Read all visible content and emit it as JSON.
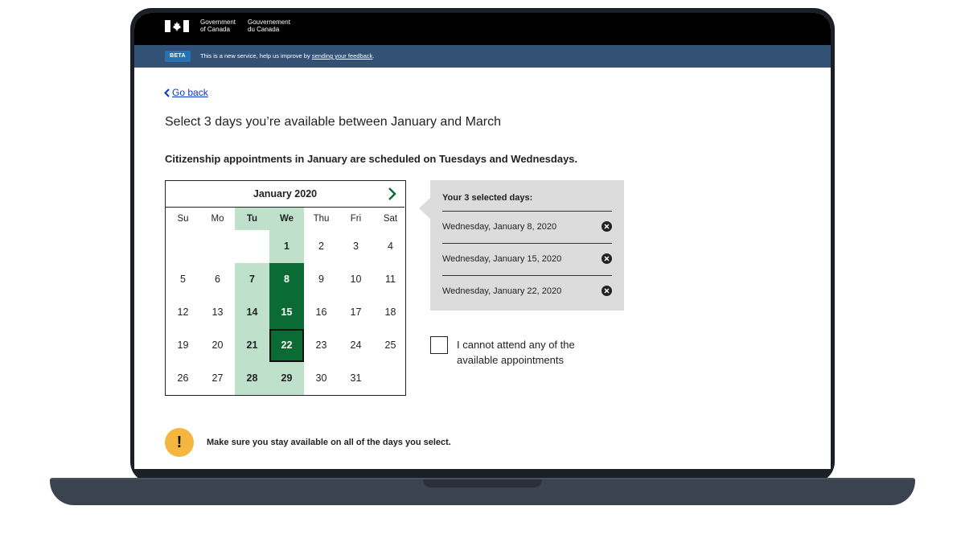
{
  "header": {
    "gov_en_line1": "Government",
    "gov_en_line2": "of Canada",
    "gov_fr_line1": "Gouvernement",
    "gov_fr_line2": "du Canada"
  },
  "beta": {
    "badge": "BETA",
    "message": "This is a new service, help us improve by ",
    "link": "sending your feedback",
    "suffix": "."
  },
  "nav": {
    "go_back": "Go back"
  },
  "page": {
    "title": "Select 3 days you’re available between January and March",
    "subhead": "Citizenship appointments in January are scheduled on Tuesdays and Wednesdays."
  },
  "calendar": {
    "month": "January 2020",
    "weekdays": [
      "Su",
      "Mo",
      "Tu",
      "We",
      "Thu",
      "Fri",
      "Sat"
    ],
    "available_weekdays": [
      "Tu",
      "We"
    ],
    "days": [
      "1",
      "2",
      "3",
      "4",
      "5",
      "6",
      "7",
      "8",
      "9",
      "10",
      "11",
      "12",
      "13",
      "14",
      "15",
      "16",
      "17",
      "18",
      "19",
      "20",
      "21",
      "22",
      "23",
      "24",
      "25",
      "26",
      "27",
      "28",
      "29",
      "30",
      "31"
    ],
    "first_weekday_index": 3,
    "selected_days": [
      8,
      15,
      22
    ],
    "focused_day": 22
  },
  "selected_panel": {
    "title": "Your 3 selected days:",
    "items": [
      "Wednesday, January 8, 2020",
      "Wednesday, January 15, 2020",
      "Wednesday, January 22, 2020"
    ]
  },
  "checkbox": {
    "label": "I cannot attend any of the available appointments",
    "checked": false
  },
  "warning": {
    "icon": "!",
    "text": "Make sure you stay available on all of the days you select."
  },
  "colors": {
    "available": "#bfe0cb",
    "selected": "#0b6b34",
    "beta_bar": "#335075",
    "warning": "#f4b63f",
    "link": "#0535d2"
  }
}
